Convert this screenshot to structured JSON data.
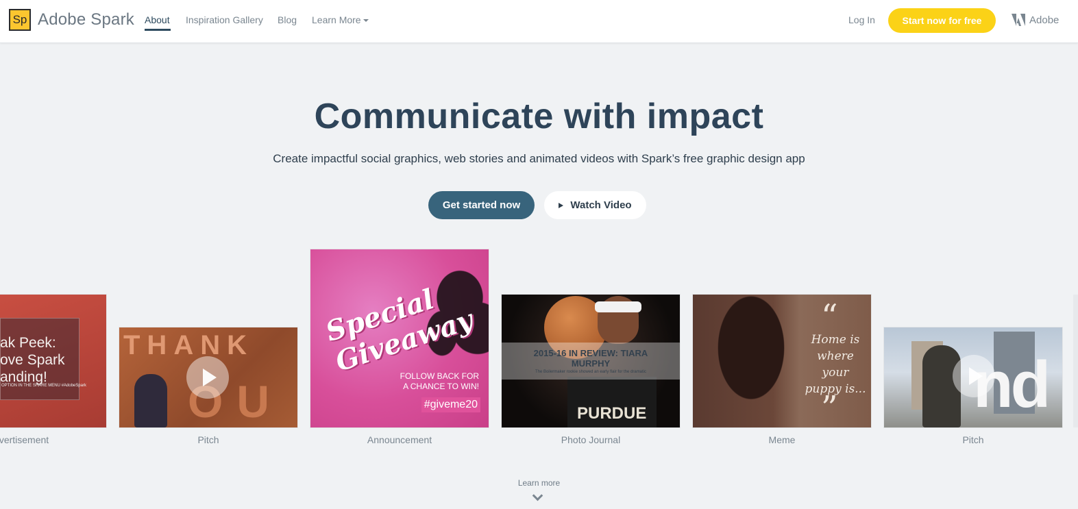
{
  "header": {
    "logo_text": "Sp",
    "brand": "Adobe Spark",
    "nav": [
      {
        "label": "About",
        "active": true
      },
      {
        "label": "Inspiration Gallery",
        "active": false
      },
      {
        "label": "Blog",
        "active": false
      },
      {
        "label": "Learn More",
        "active": false,
        "has_dropdown": true
      }
    ],
    "login_label": "Log In",
    "cta_label": "Start now for free",
    "adobe_label": "Adobe",
    "cta_color": "#fbd217"
  },
  "hero": {
    "title": "Communicate with impact",
    "subtitle": "Create impactful social graphics, web stories and animated videos with Spark’s free graphic design app",
    "primary_button": "Get started now",
    "secondary_button": "Watch Video",
    "primary_color": "#38647c"
  },
  "gallery": {
    "cards": [
      {
        "label": "vertisement",
        "image_text": "ak Peek:\nove Spark\nanding!",
        "image_subtext": "OPTION IN THE SHARE MENU  #AdobeSpark"
      },
      {
        "label": "Pitch",
        "image_text": "THANK",
        "image_text_2": "OU",
        "video": true
      },
      {
        "label": "Announcement",
        "image_text": "Special\nGiveaway",
        "image_subtext": "FOLLOW BACK FOR\nA CHANCE TO WIN!",
        "image_tag": "#giveme20"
      },
      {
        "label": "Photo Journal",
        "image_text": "2015-16 IN REVIEW: TIARA\nMURPHY",
        "image_subtext": "The Boilermaker rookie showed an early flair for the dramatic",
        "image_text_2": "PURDUE"
      },
      {
        "label": "Meme",
        "image_text": "Home is\nwhere your\npuppy is...",
        "quote_open": "“",
        "quote_close": "”"
      },
      {
        "label": "Pitch",
        "image_text": "nd",
        "video": true
      }
    ]
  },
  "footer_hint": {
    "learn_more": "Learn more"
  },
  "icons": [
    "spark-logo-icon",
    "chevron-down-icon",
    "adobe-logo-icon",
    "play-icon",
    "video-play-icon",
    "scroll-down-chevron-icon"
  ]
}
